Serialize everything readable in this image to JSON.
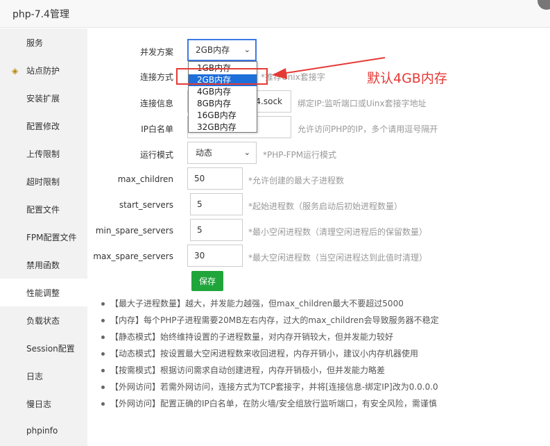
{
  "window": {
    "title": "php-7.4管理"
  },
  "sidebar": {
    "items": [
      {
        "label": "服务"
      },
      {
        "label": "站点防护"
      },
      {
        "label": "安装扩展"
      },
      {
        "label": "配置修改"
      },
      {
        "label": "上传限制"
      },
      {
        "label": "超时限制"
      },
      {
        "label": "配置文件"
      },
      {
        "label": "FPM配置文件"
      },
      {
        "label": "禁用函数"
      },
      {
        "label": "性能调整"
      },
      {
        "label": "负载状态"
      },
      {
        "label": "Session配置"
      },
      {
        "label": "日志"
      },
      {
        "label": "慢日志"
      },
      {
        "label": "phpinfo"
      }
    ],
    "active_index": 9
  },
  "form": {
    "concurrency": {
      "label": "并发方案",
      "value": "2GB内存"
    },
    "connection_mode": {
      "label": "连接方式",
      "hint_partial": "*推荐Unix套接字"
    },
    "connection_info": {
      "label": "连接信息",
      "value_partial": "4.sock",
      "hint": "绑定IP:监听端口或Uinx套接字地址"
    },
    "ip_whitelist": {
      "label": "IP白名单",
      "value": "",
      "hint": "允许访问PHP的IP，多个请用逗号隔开"
    },
    "run_mode": {
      "label": "运行模式",
      "value": "动态",
      "hint": "*PHP-FPM运行模式"
    },
    "max_children": {
      "label": "max_children",
      "value": "50",
      "hint": "*允许创建的最大子进程数"
    },
    "start_servers": {
      "label": "start_servers",
      "value": "5",
      "hint": "*起始进程数（服务启动后初始进程数量）"
    },
    "min_spare_servers": {
      "label": "min_spare_servers",
      "value": "5",
      "hint": "*最小空闲进程数（清理空闲进程后的保留数量）"
    },
    "max_spare_servers": {
      "label": "max_spare_servers",
      "value": "30",
      "hint": "*最大空闲进程数（当空闲进程达到此值时清理）"
    },
    "save_label": "保存"
  },
  "dropdown": {
    "options": [
      "1GB内存",
      "2GB内存",
      "4GB内存",
      "8GB内存",
      "16GB内存",
      "32GB内存"
    ],
    "selected_index": 1
  },
  "tips": [
    "【最大子进程数量】越大，并发能力越强，但max_children最大不要超过5000",
    "【内存】每个PHP子进程需要20MB左右内存，过大的max_children会导致服务器不稳定",
    "【静态模式】始终维持设置的子进程数量，对内存开销较大，但并发能力较好",
    "【动态模式】按设置最大空闲进程数来收回进程，内存开销小，建议小内存机器使用",
    "【按需模式】根据访问需求自动创建进程，内存开销极小，但并发能力略差",
    "【外网访问】若需外网访问，连接方式为TCP套接字，并将[连接信息-绑定IP]改为0.0.0.0",
    "【外网访问】配置正确的IP白名单，在防火墙/安全组放行监听端口，有安全风险，需谨慎"
  ],
  "annotation": {
    "text": "默认4GB内存"
  },
  "colors": {
    "accent_green": "#20a53a",
    "annotation_red": "#e53935",
    "selected_blue": "#1e6fd9"
  }
}
